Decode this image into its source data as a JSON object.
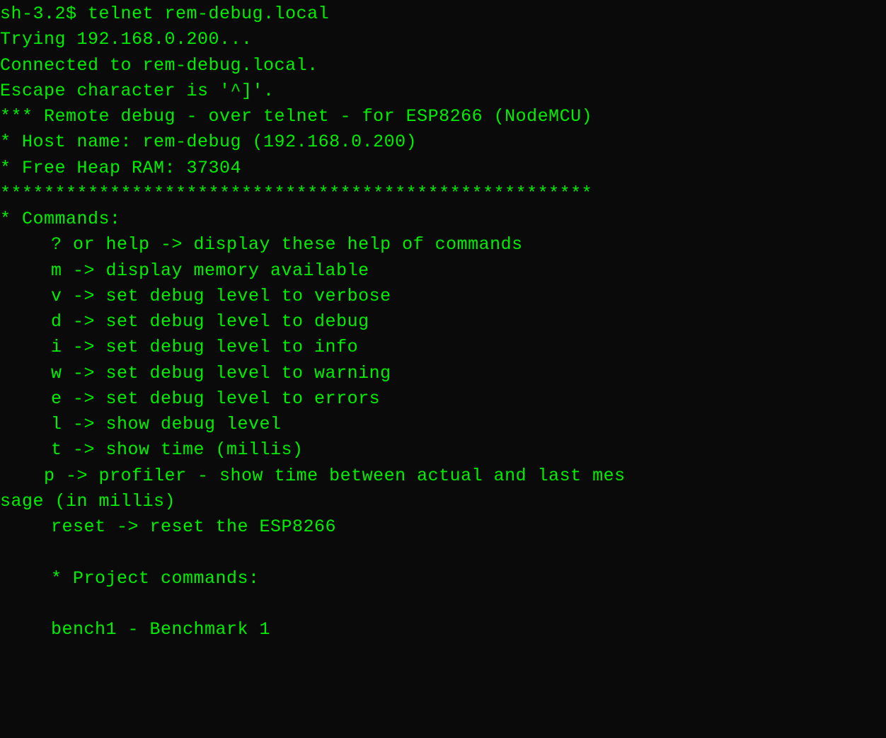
{
  "lines": {
    "prompt": "sh-3.2$ telnet rem-debug.local",
    "trying": "Trying 192.168.0.200...",
    "connected": "Connected to rem-debug.local.",
    "escape": "Escape character is '^]'.",
    "header1": "*** Remote debug - over telnet - for ESP8266 (NodeMCU)",
    "hostname": "* Host name: rem-debug (192.168.0.200)",
    "freeheap": "* Free Heap RAM: 37304",
    "stars": "******************************************************",
    "commands_header": "* Commands:",
    "cmd_help": "? or help -> display these help of commands",
    "cmd_m": "m -> display memory available",
    "cmd_v": "v -> set debug level to verbose",
    "cmd_d": "d -> set debug level to debug",
    "cmd_i": "i -> set debug level to info",
    "cmd_w": "w -> set debug level to warning",
    "cmd_e": "e -> set debug level to errors",
    "cmd_l": "l -> show debug level",
    "cmd_t": "t -> show time (millis)",
    "cmd_p_1": "    p -> profiler - show time between actual and last mes",
    "cmd_p_2": "sage (in millis)",
    "cmd_reset": "reset -> reset the ESP8266",
    "proj_header": "* Project commands:",
    "bench1": "bench1 - Benchmark 1"
  }
}
